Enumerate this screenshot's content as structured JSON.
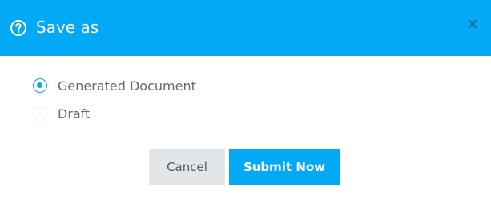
{
  "dialog": {
    "title": "Save as",
    "header_icon": "help-circle-icon",
    "close_icon": "close-icon"
  },
  "options": [
    {
      "label": "Generated Document",
      "checked": true
    },
    {
      "label": "Draft",
      "checked": false
    }
  ],
  "buttons": {
    "cancel_label": "Cancel",
    "submit_label": "Submit Now"
  },
  "colors": {
    "accent": "#03a9f4",
    "header_text": "#ffffff",
    "cancel_bg": "#e3e6e9",
    "label_text": "#666a6f"
  }
}
